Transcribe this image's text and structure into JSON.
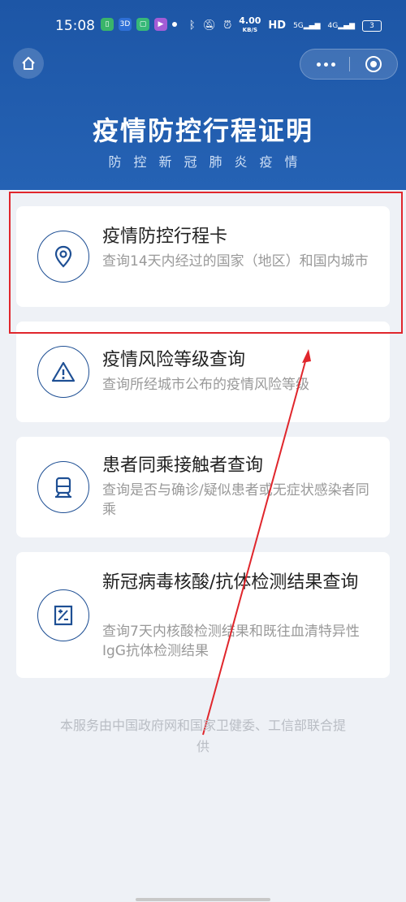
{
  "status_bar": {
    "time": "15:08",
    "app_icons": [
      {
        "name": "battery-saver-icon",
        "color": "#3ab46a",
        "glyph": "▯"
      },
      {
        "name": "3d-app-icon",
        "color": "#2e6fd6",
        "glyph": "3D"
      },
      {
        "name": "chat-app-icon",
        "color": "#37b878",
        "glyph": "▢"
      },
      {
        "name": "video-app-icon",
        "color": "#a45cd6",
        "glyph": "▶"
      }
    ],
    "speed_value": "4.00",
    "speed_unit": "KB/S",
    "hd_label": "HD",
    "network_5g": "5G",
    "network_4g": "4G",
    "battery_level": "3"
  },
  "header": {
    "title": "疫情防控行程证明",
    "subtitle": "防控新冠肺炎疫情"
  },
  "cards": [
    {
      "title": "疫情防控行程卡",
      "desc": "查询14天内经过的国家（地区）和国内城市",
      "icon": "location-pin-icon"
    },
    {
      "title": "疫情风险等级查询",
      "desc": "查询所经城市公布的疫情风险等级",
      "icon": "warning-icon"
    },
    {
      "title": "患者同乘接触者查询",
      "desc": "查询是否与确诊/疑似患者或无症状感染者同乘",
      "icon": "train-icon"
    },
    {
      "title": "新冠病毒核酸/抗体检测结果查询",
      "desc": "查询7天内核酸检测结果和既往血清特异性IgG抗体检测结果",
      "icon": "test-report-icon"
    }
  ],
  "footer": {
    "text": "本服务由中国政府网和国家卫健委、工信部联合提供"
  },
  "colors": {
    "header_blue": "#1d56a6",
    "icon_blue": "#1e4f94",
    "highlight_red": "#e0262c"
  }
}
